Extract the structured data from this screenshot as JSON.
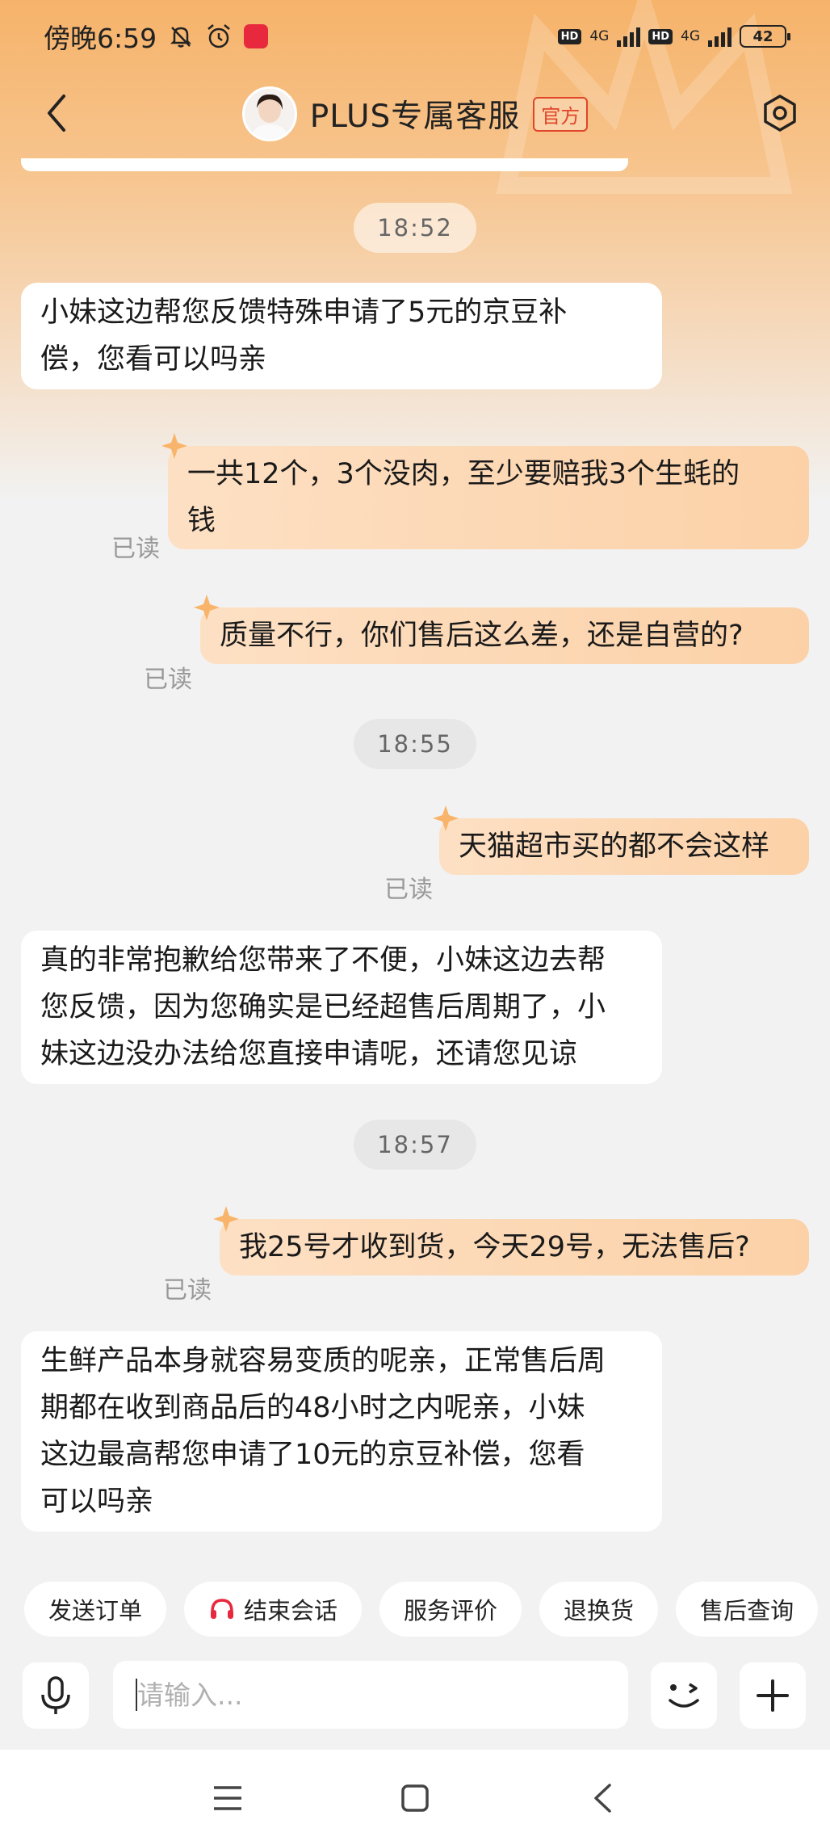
{
  "status_bar": {
    "time": "傍晚6:59",
    "signal_1": "4G",
    "signal_2": "4G",
    "hd_1": "HD",
    "hd_2": "HD",
    "battery": "42",
    "icons": [
      "mute-bell-icon",
      "alarm-icon",
      "app-notification-icon"
    ]
  },
  "header": {
    "title": "PLUS专属客服",
    "badge": "官方",
    "icons": [
      "back-chevron-icon",
      "avatar",
      "settings-hexagon-icon"
    ]
  },
  "messages": [
    {
      "type": "time",
      "text": "18:52"
    },
    {
      "type": "left",
      "lines": [
        "小妹这边帮您反馈特殊申请了5元的京豆补",
        "偿，您看可以吗亲"
      ]
    },
    {
      "type": "right",
      "read": "已读",
      "lines": [
        "一共12个，3个没肉，至少要赔我3个生蚝的",
        "钱"
      ]
    },
    {
      "type": "right",
      "read": "已读",
      "lines": [
        "质量不行，你们售后这么差，还是自营的?"
      ]
    },
    {
      "type": "time",
      "text": "18:55"
    },
    {
      "type": "right",
      "read": "已读",
      "lines": [
        "天猫超市买的都不会这样"
      ]
    },
    {
      "type": "left",
      "lines": [
        "真的非常抱歉给您带来了不便，小妹这边去帮",
        "您反馈，因为您确实是已经超售后周期了，小",
        "妹这边没办法给您直接申请呢，还请您见谅"
      ]
    },
    {
      "type": "time",
      "text": "18:57"
    },
    {
      "type": "right",
      "read": "已读",
      "lines": [
        "我25号才收到货，今天29号，无法售后?"
      ]
    },
    {
      "type": "left",
      "lines": [
        "生鲜产品本身就容易变质的呢亲，正常售后周",
        "期都在收到商品后的48小时之内呢亲，小妹",
        "这边最高帮您申请了10元的京豆补偿，您看",
        "可以吗亲"
      ]
    }
  ],
  "quick_actions": [
    "发送订单",
    "结束会话",
    "服务评价",
    "退换货",
    "售后查询"
  ],
  "input": {
    "placeholder": "请输入..."
  },
  "nav_icons": [
    "menu-icon",
    "home-square-icon",
    "back-triangle-icon"
  ],
  "colors": {
    "accent": "#f6b36a",
    "bubble_right": "#fcd1a7",
    "official_badge": "#e0452a"
  }
}
